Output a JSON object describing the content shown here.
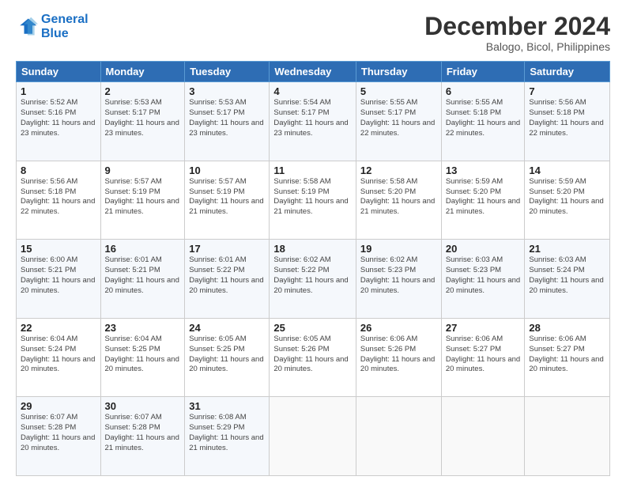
{
  "logo": {
    "line1": "General",
    "line2": "Blue"
  },
  "title": "December 2024",
  "subtitle": "Balogo, Bicol, Philippines",
  "headers": [
    "Sunday",
    "Monday",
    "Tuesday",
    "Wednesday",
    "Thursday",
    "Friday",
    "Saturday"
  ],
  "weeks": [
    [
      {
        "day": "1",
        "sunrise": "5:52 AM",
        "sunset": "5:16 PM",
        "daylight": "11 hours and 23 minutes."
      },
      {
        "day": "2",
        "sunrise": "5:53 AM",
        "sunset": "5:17 PM",
        "daylight": "11 hours and 23 minutes."
      },
      {
        "day": "3",
        "sunrise": "5:53 AM",
        "sunset": "5:17 PM",
        "daylight": "11 hours and 23 minutes."
      },
      {
        "day": "4",
        "sunrise": "5:54 AM",
        "sunset": "5:17 PM",
        "daylight": "11 hours and 23 minutes."
      },
      {
        "day": "5",
        "sunrise": "5:55 AM",
        "sunset": "5:17 PM",
        "daylight": "11 hours and 22 minutes."
      },
      {
        "day": "6",
        "sunrise": "5:55 AM",
        "sunset": "5:18 PM",
        "daylight": "11 hours and 22 minutes."
      },
      {
        "day": "7",
        "sunrise": "5:56 AM",
        "sunset": "5:18 PM",
        "daylight": "11 hours and 22 minutes."
      }
    ],
    [
      {
        "day": "8",
        "sunrise": "5:56 AM",
        "sunset": "5:18 PM",
        "daylight": "11 hours and 22 minutes."
      },
      {
        "day": "9",
        "sunrise": "5:57 AM",
        "sunset": "5:19 PM",
        "daylight": "11 hours and 21 minutes."
      },
      {
        "day": "10",
        "sunrise": "5:57 AM",
        "sunset": "5:19 PM",
        "daylight": "11 hours and 21 minutes."
      },
      {
        "day": "11",
        "sunrise": "5:58 AM",
        "sunset": "5:19 PM",
        "daylight": "11 hours and 21 minutes."
      },
      {
        "day": "12",
        "sunrise": "5:58 AM",
        "sunset": "5:20 PM",
        "daylight": "11 hours and 21 minutes."
      },
      {
        "day": "13",
        "sunrise": "5:59 AM",
        "sunset": "5:20 PM",
        "daylight": "11 hours and 21 minutes."
      },
      {
        "day": "14",
        "sunrise": "5:59 AM",
        "sunset": "5:20 PM",
        "daylight": "11 hours and 20 minutes."
      }
    ],
    [
      {
        "day": "15",
        "sunrise": "6:00 AM",
        "sunset": "5:21 PM",
        "daylight": "11 hours and 20 minutes."
      },
      {
        "day": "16",
        "sunrise": "6:01 AM",
        "sunset": "5:21 PM",
        "daylight": "11 hours and 20 minutes."
      },
      {
        "day": "17",
        "sunrise": "6:01 AM",
        "sunset": "5:22 PM",
        "daylight": "11 hours and 20 minutes."
      },
      {
        "day": "18",
        "sunrise": "6:02 AM",
        "sunset": "5:22 PM",
        "daylight": "11 hours and 20 minutes."
      },
      {
        "day": "19",
        "sunrise": "6:02 AM",
        "sunset": "5:23 PM",
        "daylight": "11 hours and 20 minutes."
      },
      {
        "day": "20",
        "sunrise": "6:03 AM",
        "sunset": "5:23 PM",
        "daylight": "11 hours and 20 minutes."
      },
      {
        "day": "21",
        "sunrise": "6:03 AM",
        "sunset": "5:24 PM",
        "daylight": "11 hours and 20 minutes."
      }
    ],
    [
      {
        "day": "22",
        "sunrise": "6:04 AM",
        "sunset": "5:24 PM",
        "daylight": "11 hours and 20 minutes."
      },
      {
        "day": "23",
        "sunrise": "6:04 AM",
        "sunset": "5:25 PM",
        "daylight": "11 hours and 20 minutes."
      },
      {
        "day": "24",
        "sunrise": "6:05 AM",
        "sunset": "5:25 PM",
        "daylight": "11 hours and 20 minutes."
      },
      {
        "day": "25",
        "sunrise": "6:05 AM",
        "sunset": "5:26 PM",
        "daylight": "11 hours and 20 minutes."
      },
      {
        "day": "26",
        "sunrise": "6:06 AM",
        "sunset": "5:26 PM",
        "daylight": "11 hours and 20 minutes."
      },
      {
        "day": "27",
        "sunrise": "6:06 AM",
        "sunset": "5:27 PM",
        "daylight": "11 hours and 20 minutes."
      },
      {
        "day": "28",
        "sunrise": "6:06 AM",
        "sunset": "5:27 PM",
        "daylight": "11 hours and 20 minutes."
      }
    ],
    [
      {
        "day": "29",
        "sunrise": "6:07 AM",
        "sunset": "5:28 PM",
        "daylight": "11 hours and 20 minutes."
      },
      {
        "day": "30",
        "sunrise": "6:07 AM",
        "sunset": "5:28 PM",
        "daylight": "11 hours and 21 minutes."
      },
      {
        "day": "31",
        "sunrise": "6:08 AM",
        "sunset": "5:29 PM",
        "daylight": "11 hours and 21 minutes."
      },
      null,
      null,
      null,
      null
    ]
  ]
}
